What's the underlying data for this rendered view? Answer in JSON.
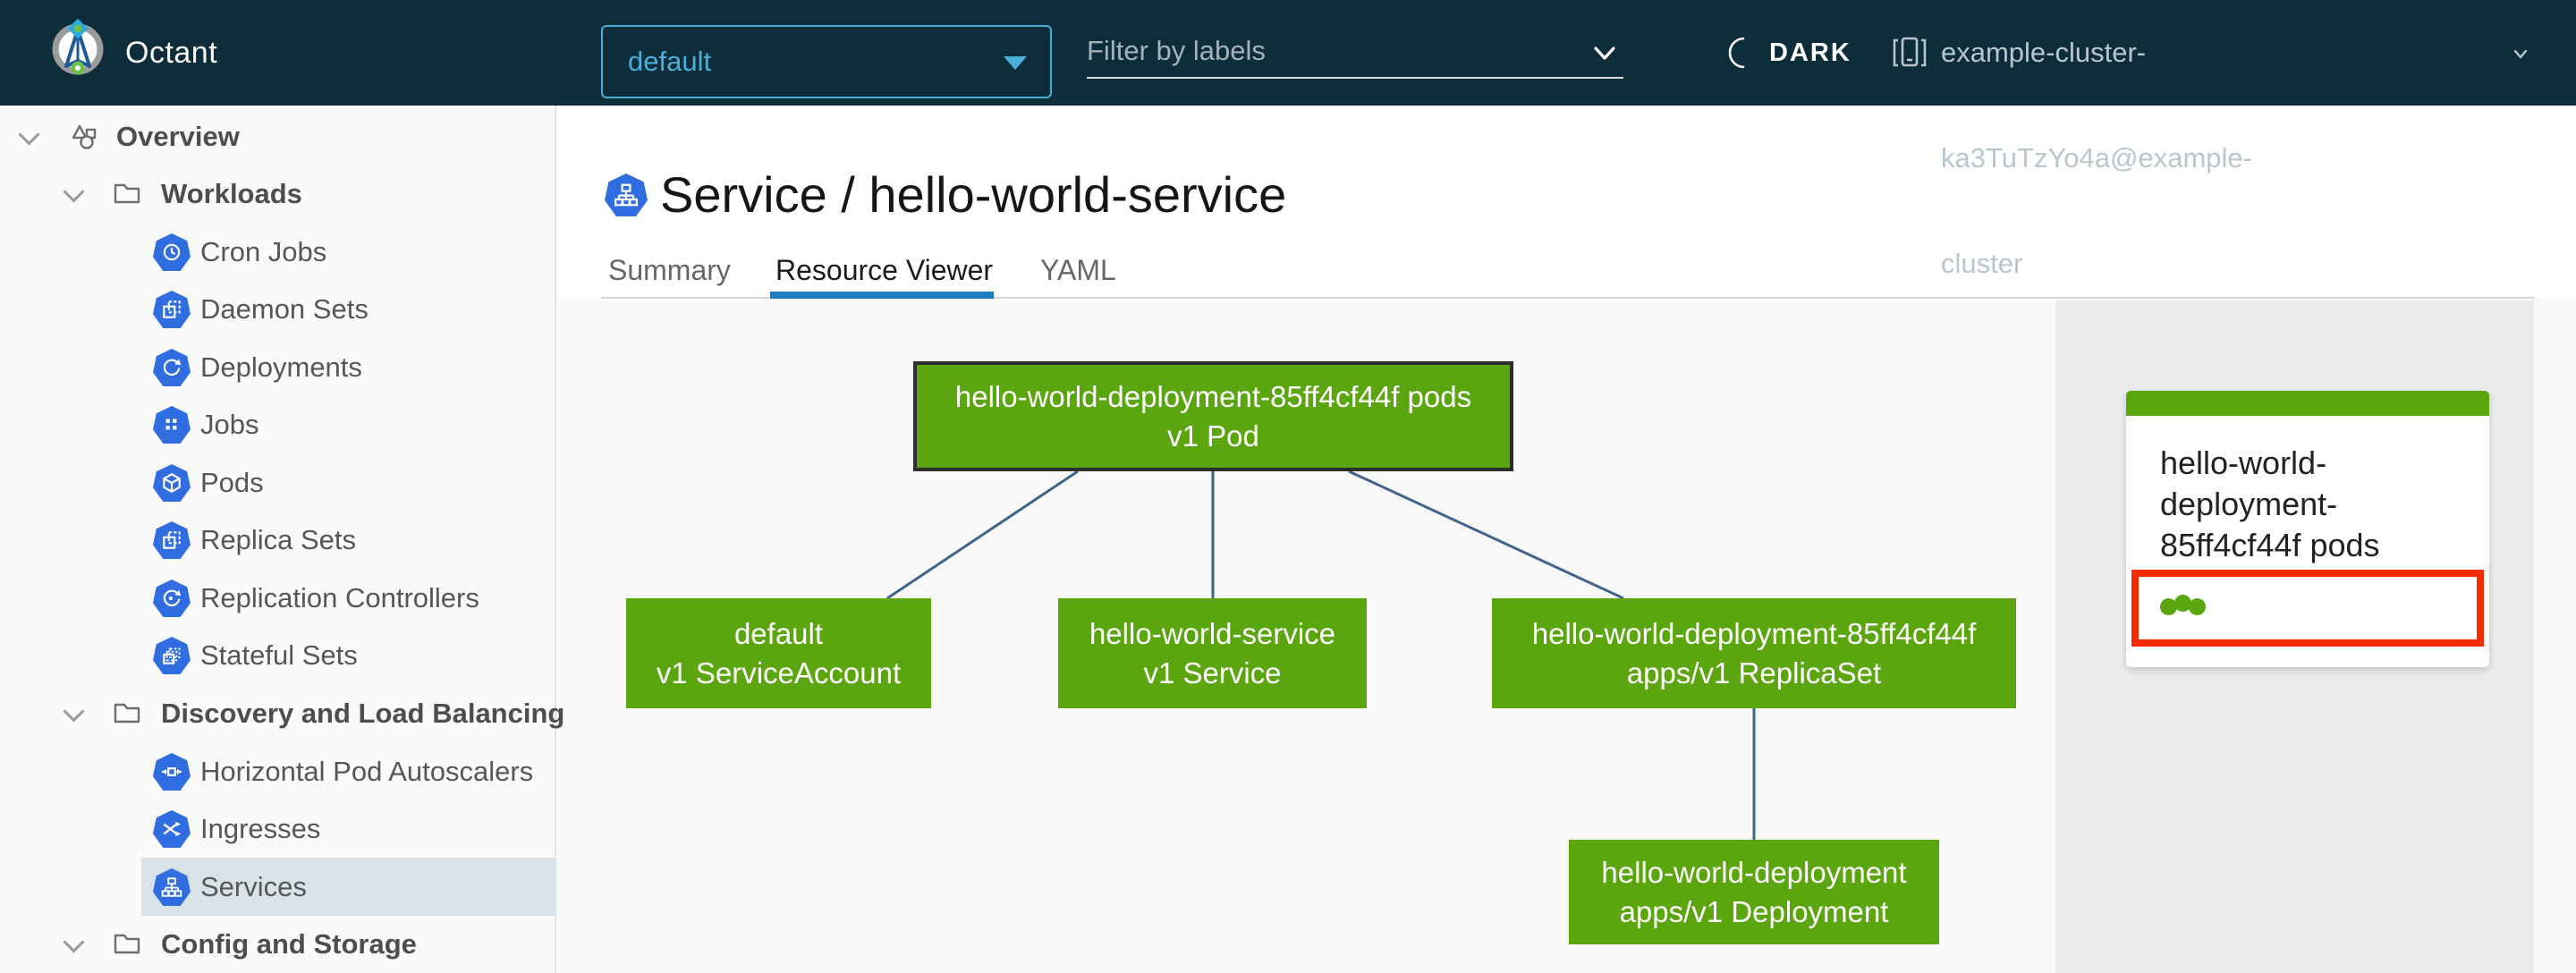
{
  "app": {
    "title": "Octant"
  },
  "header": {
    "namespace_selector": {
      "value": "default"
    },
    "filter": {
      "placeholder": "Filter by labels"
    },
    "theme_toggle": {
      "label": "DARK"
    },
    "context": {
      "label": "example-cluster-ka3TuTzYo4a@example-cluster"
    }
  },
  "sidebar": {
    "items": [
      {
        "label": "Overview",
        "level": 1,
        "icon": "objects-icon",
        "selected": false
      },
      {
        "label": "Workloads",
        "level": 2,
        "icon": "folder-icon",
        "selected": false
      },
      {
        "label": "Cron Jobs",
        "level": 3,
        "icon": "cron-jobs-icon",
        "selected": false
      },
      {
        "label": "Daemon Sets",
        "level": 3,
        "icon": "daemon-sets-icon",
        "selected": false
      },
      {
        "label": "Deployments",
        "level": 3,
        "icon": "deployments-icon",
        "selected": false
      },
      {
        "label": "Jobs",
        "level": 3,
        "icon": "jobs-icon",
        "selected": false
      },
      {
        "label": "Pods",
        "level": 3,
        "icon": "pods-icon",
        "selected": false
      },
      {
        "label": "Replica Sets",
        "level": 3,
        "icon": "replica-sets-icon",
        "selected": false
      },
      {
        "label": "Replication Controllers",
        "level": 3,
        "icon": "replication-controllers-icon",
        "selected": false
      },
      {
        "label": "Stateful Sets",
        "level": 3,
        "icon": "stateful-sets-icon",
        "selected": false
      },
      {
        "label": "Discovery and Load Balancing",
        "level": 2,
        "icon": "folder-icon",
        "selected": false
      },
      {
        "label": "Horizontal Pod Autoscalers",
        "level": 3,
        "icon": "hpa-icon",
        "selected": false
      },
      {
        "label": "Ingresses",
        "level": 3,
        "icon": "ingresses-icon",
        "selected": false
      },
      {
        "label": "Services",
        "level": 3,
        "icon": "services-icon",
        "selected": true
      },
      {
        "label": "Config and Storage",
        "level": 2,
        "icon": "folder-icon",
        "selected": false
      }
    ]
  },
  "main": {
    "title": "Service / hello-world-service",
    "title_icon": "service-icon",
    "tabs": [
      {
        "label": "Summary",
        "active": false
      },
      {
        "label": "Resource Viewer",
        "active": true
      },
      {
        "label": "YAML",
        "active": false
      }
    ]
  },
  "graph": {
    "nodes": [
      {
        "id": "pod",
        "line1": "hello-world-deployment-85ff4cf44f pods",
        "line2": "v1 Pod",
        "selected": true
      },
      {
        "id": "serviceaccount",
        "line1": "default",
        "line2": "v1 ServiceAccount",
        "selected": false
      },
      {
        "id": "service",
        "line1": "hello-world-service",
        "line2": "v1 Service",
        "selected": false
      },
      {
        "id": "replicaset",
        "line1": "hello-world-deployment-85ff4cf44f",
        "line2": "apps/v1 ReplicaSet",
        "selected": false
      },
      {
        "id": "deployment",
        "line1": "hello-world-deployment",
        "line2": "apps/v1 Deployment",
        "selected": false
      }
    ]
  },
  "side_panel": {
    "card": {
      "title": "hello-world-deployment-85ff4cf44f pods",
      "pod_count": 3,
      "status": "ok"
    }
  },
  "colors": {
    "header_bg": "#0e2d3b",
    "accent_blue": "#49afd9",
    "icon_blue": "#2f6de0",
    "node_green": "#5ba60f",
    "edge_blue": "#3f648c",
    "tab_underline": "#1d7fbf",
    "selected_row_bg": "#d8e3e9",
    "highlight_red": "#f42d00"
  }
}
